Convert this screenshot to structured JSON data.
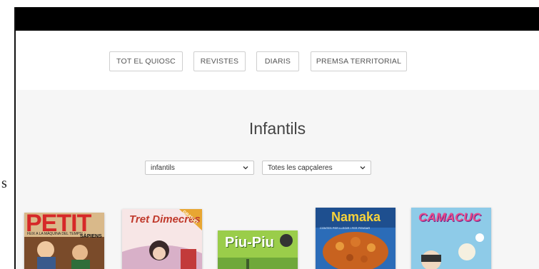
{
  "page_fragment_left": "s",
  "nav": {
    "buttons": [
      "TOT EL QUIOSC",
      "REVISTES",
      "DIARIS",
      "PREMSA TERRITORIAL"
    ]
  },
  "section_title": "Infantils",
  "filters": {
    "category": "infantils",
    "title_filter": "Totes les capçaleres"
  },
  "covers": [
    {
      "title": "PETIT",
      "subtitle": "SÀPIENS",
      "tagline": "FEIX A LA MÀQUINA DEL TEMPS!",
      "bg": "#c9302c"
    },
    {
      "title": "Tret Dimecres",
      "badge": "GRATUÏT",
      "bg": "#f3c8c8"
    },
    {
      "title": "Piu-Piu",
      "bg": "#8dc63f"
    },
    {
      "title": "Namaka",
      "subtitle": "CONTES PER LLEGIR I FER PENSAR",
      "bg": "#1f5fa8"
    },
    {
      "title": "CAMACUC",
      "bg": "#7ec4e8"
    }
  ]
}
